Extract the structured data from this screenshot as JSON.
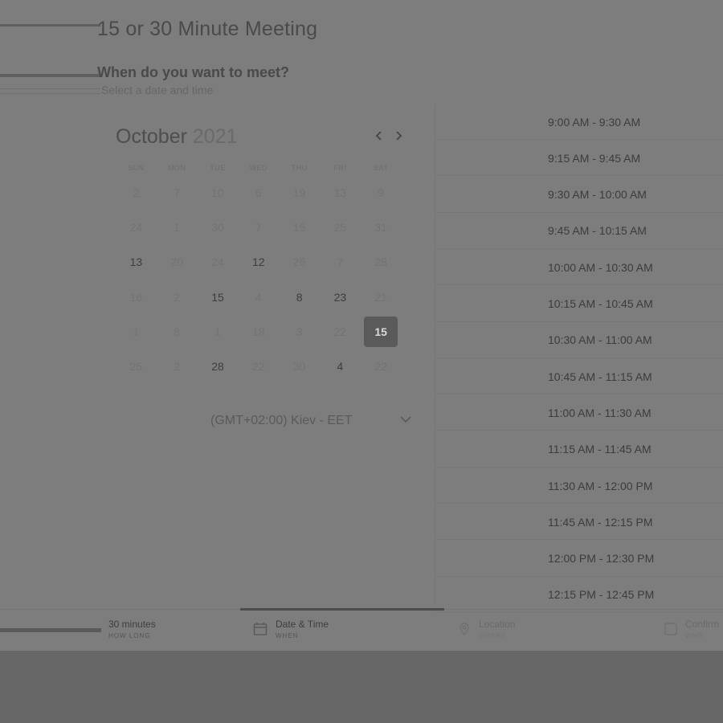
{
  "page": {
    "title": "15 or 30 Minute Meeting",
    "section_title": "When do you want to meet?",
    "section_subtitle": "Select a date and time"
  },
  "calendar": {
    "month": "October",
    "year": "2021",
    "weekdays": [
      "SUN",
      "MON",
      "TUE",
      "WED",
      "THU",
      "FRI",
      "SAT"
    ],
    "rows": [
      [
        {
          "d": "2",
          "a": false
        },
        {
          "d": "7",
          "a": false
        },
        {
          "d": "10",
          "a": false
        },
        {
          "d": "6",
          "a": false
        },
        {
          "d": "19",
          "a": false
        },
        {
          "d": "13",
          "a": false
        },
        {
          "d": "9",
          "a": false
        }
      ],
      [
        {
          "d": "24",
          "a": false
        },
        {
          "d": "1",
          "a": false
        },
        {
          "d": "30",
          "a": false
        },
        {
          "d": "7",
          "a": false
        },
        {
          "d": "15",
          "a": false
        },
        {
          "d": "25",
          "a": false
        },
        {
          "d": "31",
          "a": false
        }
      ],
      [
        {
          "d": "13",
          "a": true
        },
        {
          "d": "20",
          "a": false
        },
        {
          "d": "24",
          "a": false
        },
        {
          "d": "12",
          "a": true
        },
        {
          "d": "26",
          "a": false
        },
        {
          "d": "7",
          "a": false
        },
        {
          "d": "28",
          "a": false
        }
      ],
      [
        {
          "d": "16",
          "a": false
        },
        {
          "d": "2",
          "a": false
        },
        {
          "d": "15",
          "a": true
        },
        {
          "d": "4",
          "a": false
        },
        {
          "d": "8",
          "a": true
        },
        {
          "d": "23",
          "a": true
        },
        {
          "d": "21",
          "a": false
        }
      ],
      [
        {
          "d": "1",
          "a": false
        },
        {
          "d": "8",
          "a": false
        },
        {
          "d": "1",
          "a": false
        },
        {
          "d": "18",
          "a": false
        },
        {
          "d": "3",
          "a": false
        },
        {
          "d": "22",
          "a": false
        },
        {
          "d": "15",
          "a": true,
          "selected": true
        }
      ],
      [
        {
          "d": "25",
          "a": false
        },
        {
          "d": "2",
          "a": false
        },
        {
          "d": "28",
          "a": true
        },
        {
          "d": "22",
          "a": false
        },
        {
          "d": "30",
          "a": false
        },
        {
          "d": "4",
          "a": true
        },
        {
          "d": "22",
          "a": false
        }
      ]
    ],
    "timezone": "(GMT+02:00) Kiev - EET"
  },
  "time_slots": [
    "9:00 AM - 9:30 AM",
    "9:15 AM - 9:45 AM",
    "9:30 AM - 10:00 AM",
    "9:45 AM - 10:15 AM",
    "10:00 AM - 10:30 AM",
    "10:15 AM - 10:45 AM",
    "10:30 AM - 11:00 AM",
    "10:45 AM - 11:15 AM",
    "11:00 AM - 11:30 AM",
    "11:15 AM - 11:45 AM",
    "11:30 AM - 12:00 PM",
    "11:45 AM - 12:15 PM",
    "12:00 PM - 12:30 PM",
    "12:15 PM - 12:45 PM"
  ],
  "footer_steps": {
    "duration": {
      "label": "30 minutes",
      "sub": "HOW LONG"
    },
    "datetime": {
      "label": "Date & Time",
      "sub": "WHEN"
    },
    "location": {
      "label": "Location",
      "sub": "WHERE"
    },
    "confirm": {
      "label": "Confirm",
      "sub": "WHO"
    }
  },
  "icons": {
    "prev": "chevron-left-icon",
    "next": "chevron-right-icon",
    "timezone_dropdown": "chevron-down-icon",
    "datetime_step": "calendar-icon",
    "location_step": "map-pin-icon",
    "confirm_step": "checkbox-icon"
  }
}
